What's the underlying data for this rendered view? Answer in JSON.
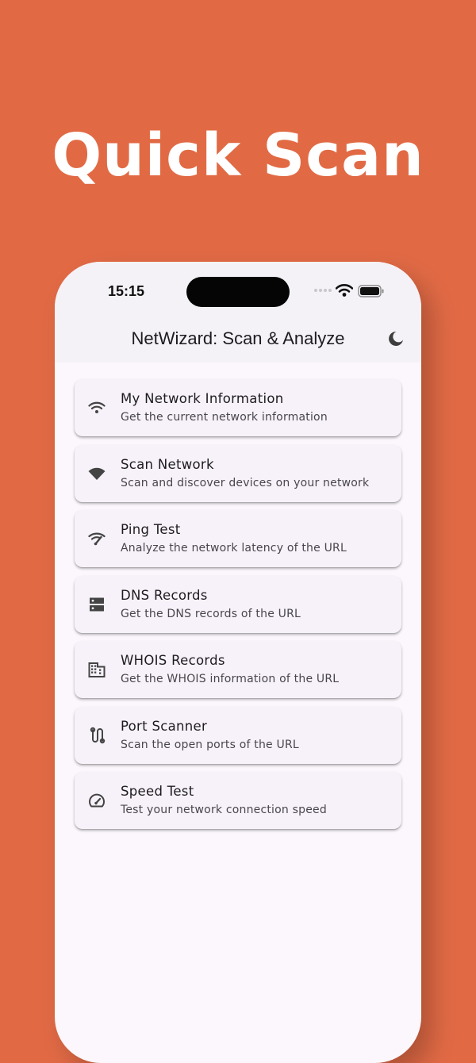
{
  "headline": "Quick Scan",
  "colors": {
    "background": "#E16A45",
    "screen": "#FBF7FC",
    "card": "#F7F2F9",
    "icon": "#444444"
  },
  "status_bar": {
    "time": "15:15",
    "icons": [
      "signal-dots-icon",
      "wifi-icon",
      "battery-icon"
    ]
  },
  "app_bar": {
    "title": "NetWizard: Scan & Analyze",
    "action_icon": "moon-icon"
  },
  "menu": [
    {
      "title": "My Network Information",
      "subtitle": "Get the current network information",
      "icon": "wifi-icon"
    },
    {
      "title": "Scan Network",
      "subtitle": "Scan and discover devices on your network",
      "icon": "wifi-filled-icon"
    },
    {
      "title": "Ping Test",
      "subtitle": "Analyze the network latency of the URL",
      "icon": "signal-speed-icon"
    },
    {
      "title": "DNS Records",
      "subtitle": "Get the DNS records of the URL",
      "icon": "dns-icon"
    },
    {
      "title": "WHOIS Records",
      "subtitle": "Get the WHOIS information of the URL",
      "icon": "building-icon"
    },
    {
      "title": "Port Scanner",
      "subtitle": "Scan the open ports of the URL",
      "icon": "route-icon"
    },
    {
      "title": "Speed Test",
      "subtitle": "Test your network connection speed",
      "icon": "speedometer-icon"
    }
  ]
}
